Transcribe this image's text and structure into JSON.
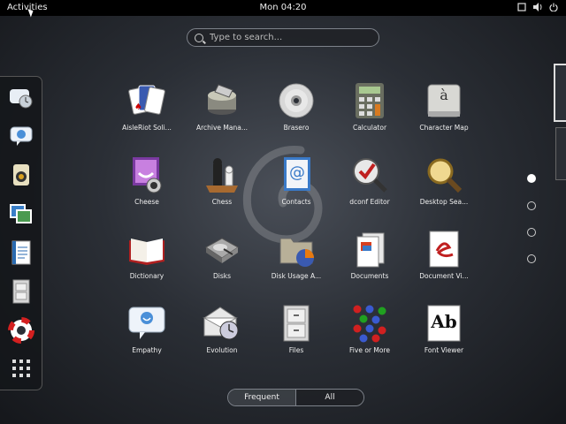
{
  "topbar": {
    "activities_label": "Activities",
    "clock": "Mon 04:20",
    "icons": [
      "window-icon",
      "volume-icon",
      "power-icon"
    ]
  },
  "search": {
    "placeholder": "Type to search..."
  },
  "dash": {
    "items": [
      "empathy-icon",
      "chat-icon",
      "speaker-icon",
      "photos-icon",
      "document-icon",
      "files-icon",
      "help-icon"
    ],
    "show_apps": "apps-grid-icon"
  },
  "pages": {
    "count": 4,
    "active": 0
  },
  "apps": [
    {
      "label": "AisleRiot Soli...",
      "icon": "cards-icon"
    },
    {
      "label": "Archive Mana...",
      "icon": "archive-icon"
    },
    {
      "label": "Brasero",
      "icon": "disc-icon"
    },
    {
      "label": "Calculator",
      "icon": "calculator-icon"
    },
    {
      "label": "Character Map",
      "icon": "charmap-icon"
    },
    {
      "label": "Cheese",
      "icon": "cheese-icon"
    },
    {
      "label": "Chess",
      "icon": "chess-icon"
    },
    {
      "label": "Contacts",
      "icon": "contacts-icon"
    },
    {
      "label": "dconf Editor",
      "icon": "dconf-icon"
    },
    {
      "label": "Desktop Sea...",
      "icon": "magnifier-icon"
    },
    {
      "label": "Dictionary",
      "icon": "book-icon"
    },
    {
      "label": "Disks",
      "icon": "disk-icon"
    },
    {
      "label": "Disk Usage A...",
      "icon": "disk-usage-icon"
    },
    {
      "label": "Documents",
      "icon": "documents-icon"
    },
    {
      "label": "Document Vi...",
      "icon": "document-viewer-icon"
    },
    {
      "label": "Empathy",
      "icon": "empathy-icon"
    },
    {
      "label": "Evolution",
      "icon": "evolution-icon"
    },
    {
      "label": "Files",
      "icon": "cabinet-icon"
    },
    {
      "label": "Five or More",
      "icon": "five-or-more-icon"
    },
    {
      "label": "Font Viewer",
      "icon": "font-icon"
    }
  ],
  "charmap_glyph": "à",
  "font_glyph": "Ab",
  "contacts_glyph": "@",
  "view": {
    "frequent_label": "Frequent",
    "all_label": "All",
    "selected": "Frequent"
  }
}
